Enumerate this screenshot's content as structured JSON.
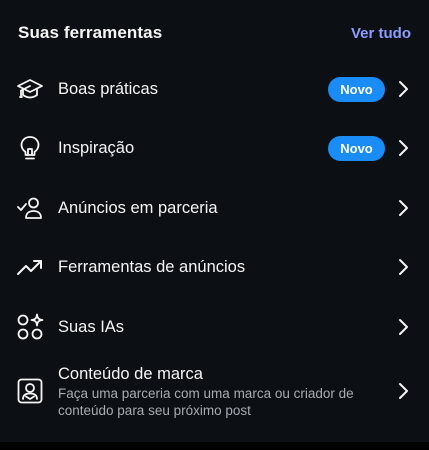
{
  "header": {
    "title": "Suas ferramentas",
    "see_all": "Ver tudo"
  },
  "items": [
    {
      "label": "Boas práticas",
      "badge": "Novo",
      "icon": "graduation-cap-icon"
    },
    {
      "label": "Inspiração",
      "badge": "Novo",
      "icon": "lightbulb-icon"
    },
    {
      "label": "Anúncios em parceria",
      "icon": "partner-user-check-icon"
    },
    {
      "label": "Ferramentas de anúncios",
      "icon": "trending-up-icon"
    },
    {
      "label": "Suas IAs",
      "icon": "ai-sparkle-icon"
    },
    {
      "label": "Conteúdo de marca",
      "description": "Faça uma parceria com uma marca ou criador de conteúdo para seu próximo post",
      "icon": "branded-content-icon"
    }
  ],
  "colors": {
    "background": "#0c1014",
    "accent_link": "#8e9cff",
    "badge": "#1a8cf5",
    "text": "#f5f5f5",
    "secondary_text": "#a8acb2"
  }
}
